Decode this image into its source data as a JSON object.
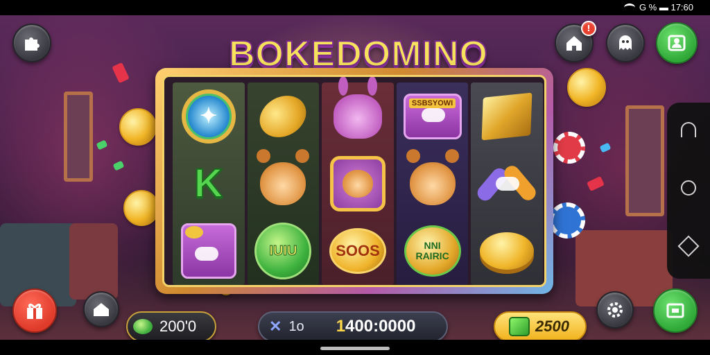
{
  "status_bar": {
    "text": "G % ▬ 17:60"
  },
  "logo": {
    "title": "BOKEDOMINO"
  },
  "top_buttons": {
    "notification_badge": "!",
    "icons": [
      "puzzle-icon",
      "home-icon",
      "ghost-icon",
      "person-icon"
    ]
  },
  "reels": [
    {
      "symbols": [
        "wheel",
        "letter-k",
        "purple-card"
      ]
    },
    {
      "symbols": [
        "lemon",
        "bear",
        "green-coin"
      ]
    },
    {
      "symbols": [
        "bunny",
        "framed-bear",
        "gold-coin"
      ]
    },
    {
      "symbols": [
        "sign-card",
        "bear",
        "badge-coin"
      ]
    },
    {
      "symbols": [
        "gold-bar",
        "bow",
        "gold-ingot"
      ]
    }
  ],
  "symbol_text": {
    "letter_k": "K",
    "sign_label": "SSBSYOWI",
    "green_coin": "IUIU",
    "gold_coin": "SOOS",
    "badge_line1": "NNI",
    "badge_line2": "RAIRIC"
  },
  "bottom_bar": {
    "balance": "200'0",
    "bet_multiplier": "1o",
    "win_first_digit": "1",
    "win_rest": "400:0000",
    "cash": "2500",
    "icons": [
      "gift-icon",
      "home-icon",
      "gem-icon",
      "cross-icon",
      "cube-icon",
      "gear-icon",
      "screen-icon"
    ]
  },
  "colors": {
    "accent_green": "#3fb33f",
    "accent_red": "#df3a2a",
    "gold": "#f1b21d",
    "frame_pink": "#b45aa8"
  }
}
